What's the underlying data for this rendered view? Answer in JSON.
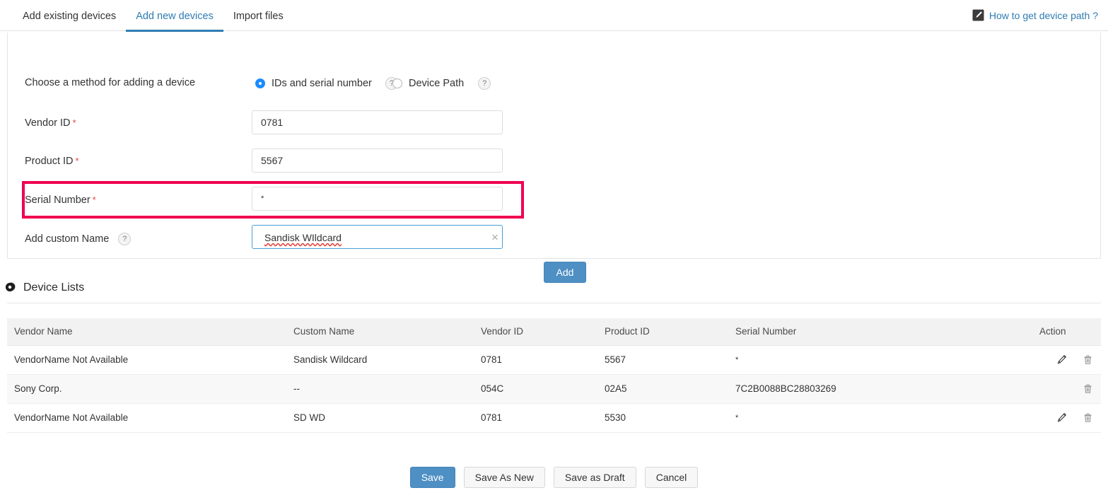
{
  "tabs": [
    {
      "label": "Add existing devices",
      "active": false
    },
    {
      "label": "Add new devices",
      "active": true
    },
    {
      "label": "Import files",
      "active": false
    }
  ],
  "header": {
    "help_link": "How to get device path ?",
    "help_icon": "edit-square-icon"
  },
  "form": {
    "method_label": "Choose a method for adding a device",
    "methods": [
      {
        "label": "IDs and serial number",
        "selected": true,
        "help": "?"
      },
      {
        "label": "Device Path",
        "selected": false,
        "help": "?"
      }
    ],
    "fields": [
      {
        "label": "Vendor ID",
        "required": "*",
        "value": "0781"
      },
      {
        "label": "Product ID",
        "required": "*",
        "value": "5567"
      },
      {
        "label": "Serial Number",
        "required": "*",
        "value": "*"
      }
    ],
    "custom_name": {
      "label": "Add custom Name",
      "help": "?",
      "value": "Sandisk WIldcard",
      "clear_icon": "×"
    },
    "add_button": "Add",
    "highlight_color": "#f00050"
  },
  "device_lists": {
    "title": "Device Lists",
    "icon": "gear-icon",
    "columns": [
      "Vendor Name",
      "Custom Name",
      "Vendor ID",
      "Product ID",
      "Serial Number",
      "Action"
    ],
    "rows": [
      {
        "vendor_name": "VendorName Not Available",
        "custom_name": "Sandisk Wildcard",
        "vendor_id": "0781",
        "product_id": "5567",
        "serial_number": "*",
        "has_edit": true,
        "has_delete": true
      },
      {
        "vendor_name": "Sony Corp.",
        "custom_name": "--",
        "vendor_id": "054C",
        "product_id": "02A5",
        "serial_number": "7C2B0088BC28803269",
        "has_edit": false,
        "has_delete": true
      },
      {
        "vendor_name": "VendorName Not Available",
        "custom_name": "SD WD",
        "vendor_id": "0781",
        "product_id": "5530",
        "serial_number": "*",
        "has_edit": true,
        "has_delete": true
      }
    ]
  },
  "footer": {
    "buttons": [
      {
        "label": "Save",
        "primary": true
      },
      {
        "label": "Save As New",
        "primary": false
      },
      {
        "label": "Save as Draft",
        "primary": false
      },
      {
        "label": "Cancel",
        "primary": false
      }
    ]
  },
  "colors": {
    "accent_blue": "#2e7cb3",
    "primary_button": "#4e8fc4",
    "required_red": "#e8453c",
    "highlight_pink": "#f00050",
    "radio_blue": "#1a8cff"
  }
}
